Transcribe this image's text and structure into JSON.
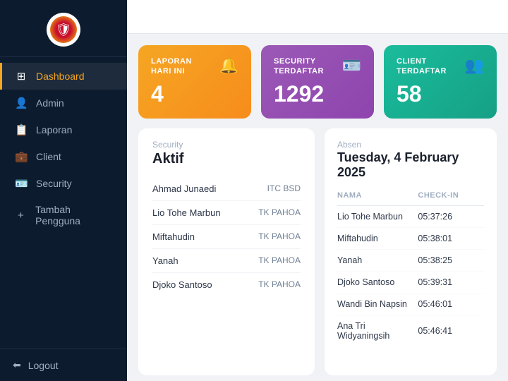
{
  "sidebar": {
    "logo_emoji": "🛡",
    "nav_items": [
      {
        "id": "dashboard",
        "label": "Dashboard",
        "icon": "⊞",
        "active": true
      },
      {
        "id": "admin",
        "label": "Admin",
        "icon": "👤",
        "active": false
      },
      {
        "id": "laporan",
        "label": "Laporan",
        "icon": "📋",
        "active": false
      },
      {
        "id": "client",
        "label": "Client",
        "icon": "💼",
        "active": false
      },
      {
        "id": "security",
        "label": "Security",
        "icon": "🪪",
        "active": false
      },
      {
        "id": "tambah-pengguna",
        "label": "Tambah Pengguna",
        "icon": "+",
        "active": false
      }
    ],
    "logout_label": "Logout"
  },
  "stats": [
    {
      "id": "laporan",
      "label": "LAPORAN\nHARI INI",
      "value": "4",
      "type": "orange",
      "icon": "🔔"
    },
    {
      "id": "security",
      "label": "SECURITY\nTERDAFTAR",
      "value": "1292",
      "type": "purple",
      "icon": "🪪"
    },
    {
      "id": "client",
      "label": "CLIENT\nTERDAFTAR",
      "value": "58",
      "type": "teal",
      "icon": "👥"
    }
  ],
  "security_panel": {
    "subtitle": "Security",
    "title": "Aktif",
    "items": [
      {
        "name": "Ahmad Junaedi",
        "location": "ITC BSD"
      },
      {
        "name": "Lio Tohe Marbun",
        "location": "TK PAHOA"
      },
      {
        "name": "Miftahudin",
        "location": "TK PAHOA"
      },
      {
        "name": "Yanah",
        "location": "TK PAHOA"
      },
      {
        "name": "Djoko Santoso",
        "location": "TK PAHOA"
      }
    ]
  },
  "absen_panel": {
    "subtitle": "Absen",
    "date": "Tuesday, 4 February 2025",
    "col_nama": "NAMA",
    "col_checkin": "CHECK-IN",
    "rows": [
      {
        "nama": "Lio Tohe Marbun",
        "checkin": "05:37:26"
      },
      {
        "nama": "Miftahudin",
        "checkin": "05:38:01"
      },
      {
        "nama": "Yanah",
        "checkin": "05:38:25"
      },
      {
        "nama": "Djoko Santoso",
        "checkin": "05:39:31"
      },
      {
        "nama": "Wandi Bin Napsin",
        "checkin": "05:46:01"
      },
      {
        "nama": "Ana Tri Widyaningsih",
        "checkin": "05:46:41"
      }
    ]
  }
}
